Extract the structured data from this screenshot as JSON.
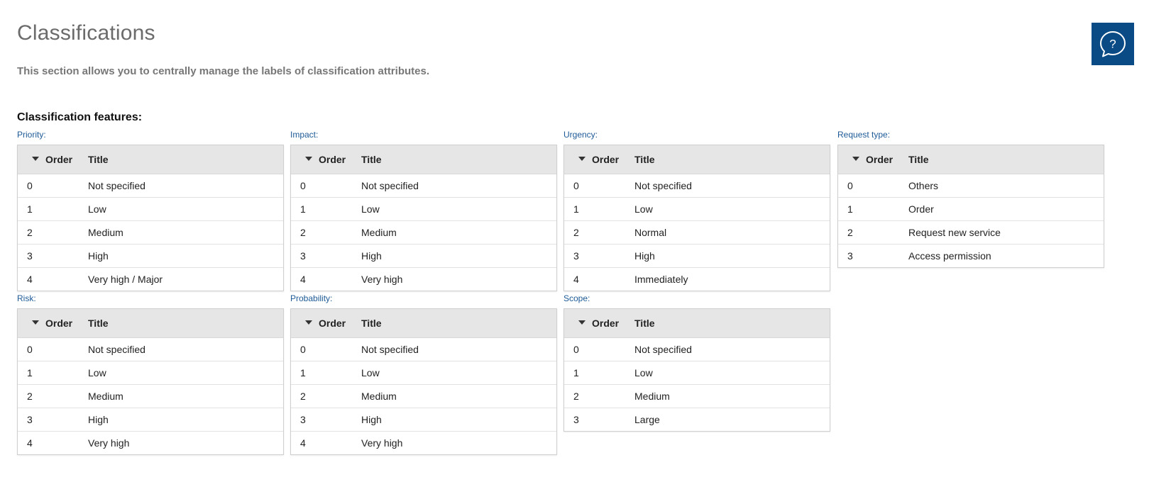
{
  "page": {
    "title": "Classifications",
    "subtitle": "This section allows you to centrally manage the labels of classification attributes."
  },
  "help": {
    "icon": "help-chat-icon",
    "color": "#0a4a85"
  },
  "features": {
    "heading": "Classification features:",
    "columns": {
      "order": "Order",
      "title": "Title"
    },
    "tables": [
      {
        "key": "priority",
        "label": "Priority:",
        "rows": [
          {
            "order": "0",
            "title": "Not specified"
          },
          {
            "order": "1",
            "title": "Low"
          },
          {
            "order": "2",
            "title": "Medium"
          },
          {
            "order": "3",
            "title": "High"
          },
          {
            "order": "4",
            "title": "Very high / Major"
          }
        ]
      },
      {
        "key": "impact",
        "label": "Impact:",
        "rows": [
          {
            "order": "0",
            "title": "Not specified"
          },
          {
            "order": "1",
            "title": "Low"
          },
          {
            "order": "2",
            "title": "Medium"
          },
          {
            "order": "3",
            "title": "High"
          },
          {
            "order": "4",
            "title": "Very high"
          }
        ]
      },
      {
        "key": "urgency",
        "label": "Urgency:",
        "rows": [
          {
            "order": "0",
            "title": "Not specified"
          },
          {
            "order": "1",
            "title": "Low"
          },
          {
            "order": "2",
            "title": "Normal"
          },
          {
            "order": "3",
            "title": "High"
          },
          {
            "order": "4",
            "title": "Immediately"
          }
        ]
      },
      {
        "key": "request-type",
        "label": "Request type:",
        "rows": [
          {
            "order": "0",
            "title": "Others"
          },
          {
            "order": "1",
            "title": "Order"
          },
          {
            "order": "2",
            "title": "Request new service"
          },
          {
            "order": "3",
            "title": "Access permission"
          }
        ]
      },
      {
        "key": "risk",
        "label": "Risk:",
        "rows": [
          {
            "order": "0",
            "title": "Not specified"
          },
          {
            "order": "1",
            "title": "Low"
          },
          {
            "order": "2",
            "title": "Medium"
          },
          {
            "order": "3",
            "title": "High"
          },
          {
            "order": "4",
            "title": "Very high"
          }
        ]
      },
      {
        "key": "probability",
        "label": "Probability:",
        "rows": [
          {
            "order": "0",
            "title": "Not specified"
          },
          {
            "order": "1",
            "title": "Low"
          },
          {
            "order": "2",
            "title": "Medium"
          },
          {
            "order": "3",
            "title": "High"
          },
          {
            "order": "4",
            "title": "Very high"
          }
        ]
      },
      {
        "key": "scope",
        "label": "Scope:",
        "rows": [
          {
            "order": "0",
            "title": "Not specified"
          },
          {
            "order": "1",
            "title": "Low"
          },
          {
            "order": "2",
            "title": "Medium"
          },
          {
            "order": "3",
            "title": "Large"
          }
        ]
      }
    ]
  }
}
